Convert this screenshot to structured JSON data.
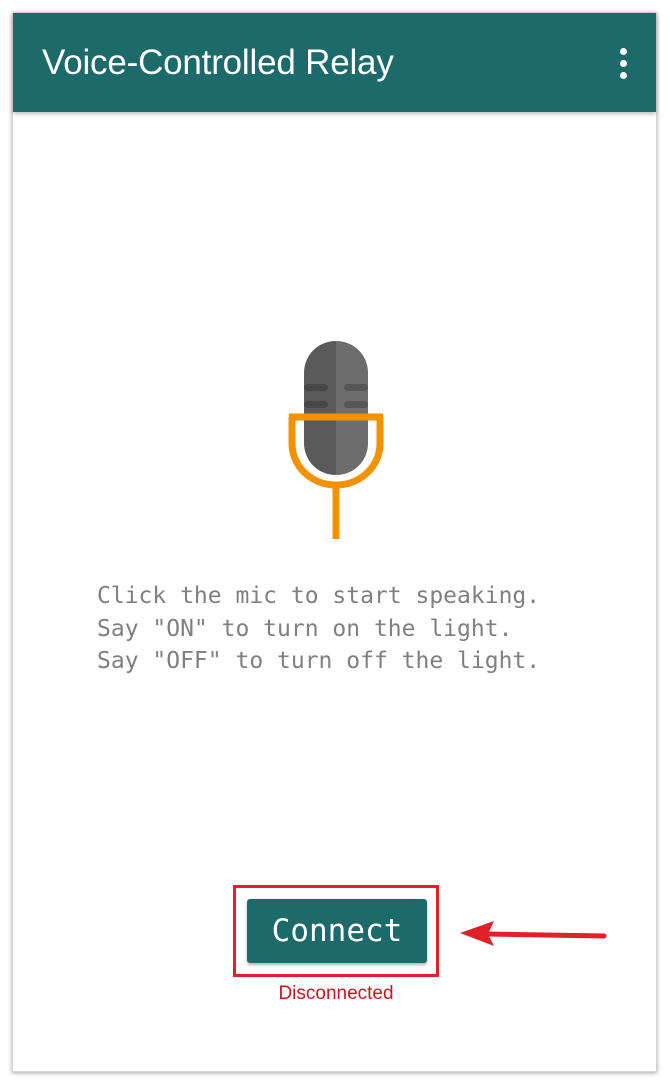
{
  "app": {
    "title": "Voice-Controlled Relay",
    "menu_icon": "more-vert-icon"
  },
  "mic": {
    "icon": "microphone-icon"
  },
  "instructions": {
    "text": "Click the mic to start speaking.\nSay \"ON\" to turn on the light.\nSay \"OFF\" to turn off the light."
  },
  "connect": {
    "label": "Connect",
    "status": "Disconnected"
  },
  "annotation": {
    "arrow_icon": "left-arrow-icon"
  },
  "colors": {
    "app_bar": "#1c6a69",
    "button": "#1c6a69",
    "mic_body": "#5a5a5a",
    "mic_stand": "#f39200",
    "instructions_text": "#808080",
    "status_text": "#c8161d",
    "annotation_red": "#e0202b"
  }
}
